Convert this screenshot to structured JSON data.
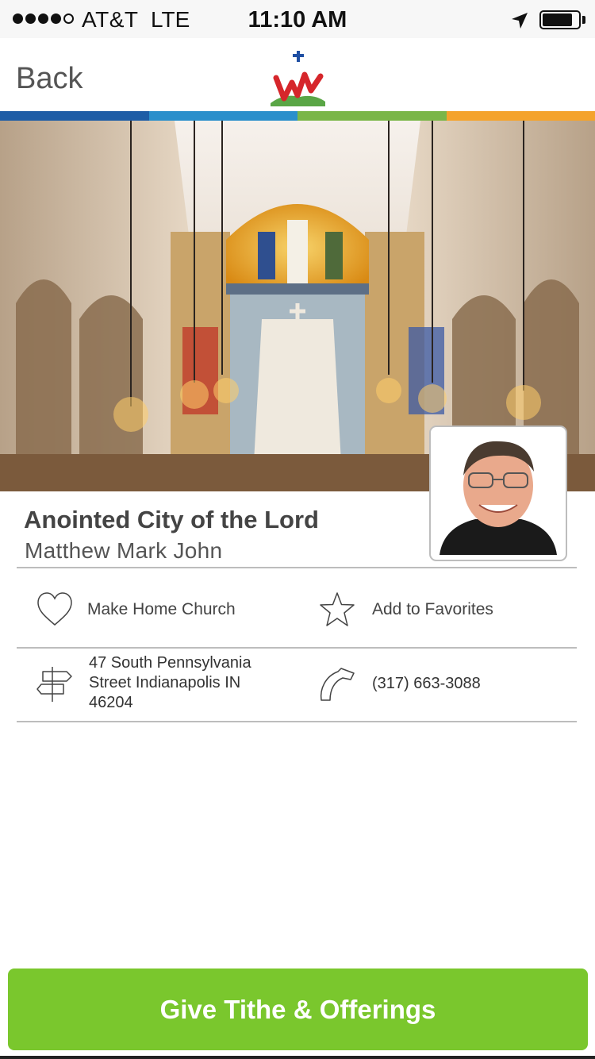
{
  "status_bar": {
    "carrier": "AT&T",
    "network": "LTE",
    "time": "11:10 AM",
    "signal_bars_filled": 4,
    "signal_bars_total": 5,
    "battery_level": 0.85
  },
  "nav": {
    "back_label": "Back",
    "logo_icon": "cross-w-mountain-logo"
  },
  "brand_stripe_colors": [
    "#1e5da6",
    "#2a8fcb",
    "#7ab648",
    "#f4a32c"
  ],
  "church": {
    "name": "Anointed City of the Lord",
    "pastor": "Matthew Mark John",
    "hero_image": "church-interior-photo",
    "pastor_photo": "pastor-portrait-photo"
  },
  "actions": {
    "home_church": {
      "label": "Make Home Church",
      "icon": "heart-icon"
    },
    "favorites": {
      "label": "Add to Favorites",
      "icon": "star-icon"
    }
  },
  "contact": {
    "address_lines": [
      "47 South Pennsylvania",
      "Street Indianapolis IN",
      "46204"
    ],
    "address_icon": "signpost-icon",
    "phone": "(317) 663-3088",
    "phone_icon": "phone-handset-icon"
  },
  "cta": {
    "label": "Give Tithe & Offerings",
    "color": "#7ac72d"
  }
}
